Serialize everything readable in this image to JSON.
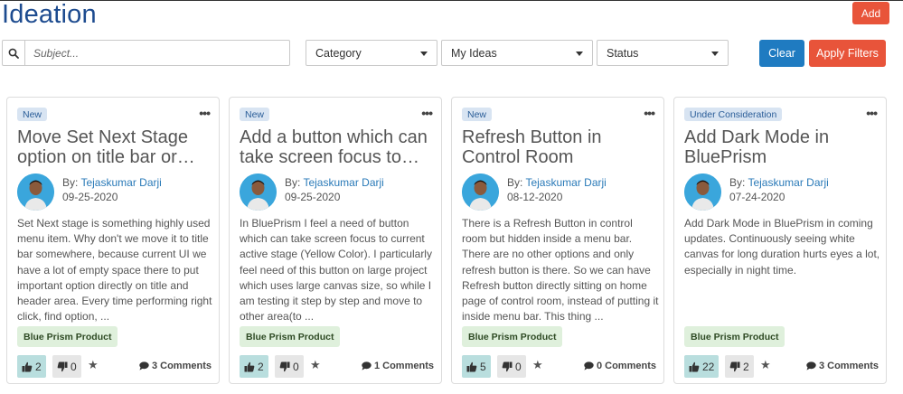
{
  "header": {
    "title": "Ideation",
    "add_label": "Add"
  },
  "filters": {
    "search_placeholder": "Subject...",
    "category": "Category",
    "my_ideas": "My Ideas",
    "status": "Status",
    "clear_label": "Clear",
    "apply_label": "Apply Filters"
  },
  "cards": [
    {
      "status": "New",
      "title": "Move Set Next Stage option on title bar or header",
      "by_label": "By:",
      "author": "Tejaskumar Darji",
      "date": "09-25-2020",
      "description": "Set Next stage is something highly used menu item. Why don't we move it to title bar somewhere, because current UI we have a lot of empty space there to put important option directly on title and header area. Every time performing right click, find option, ...",
      "tag": "Blue Prism Product",
      "upvotes": "2",
      "downvotes": "0",
      "comments": "3 Comments"
    },
    {
      "status": "New",
      "title": "Add a button which can take screen focus to current stage",
      "by_label": "By:",
      "author": "Tejaskumar Darji",
      "date": "09-25-2020",
      "description": "In BluePrism I feel a need of button which can take screen focus to current active stage (Yellow Color). I particularly feel need of this button on large project which uses large canvas size, so while I am testing it step by step and move to other area(to ...",
      "tag": "Blue Prism Product",
      "upvotes": "2",
      "downvotes": "0",
      "comments": "1 Comments"
    },
    {
      "status": "New",
      "title": "Refresh Button in Control Room",
      "by_label": "By:",
      "author": "Tejaskumar Darji",
      "date": "08-12-2020",
      "description": "There is a Refresh Button in control room but hidden inside a menu bar. There are no other options and only refresh button is there. So we can have Refresh button directly sitting on home page of control room, instead of putting it inside menu bar. This thing ...",
      "tag": "Blue Prism Product",
      "upvotes": "5",
      "downvotes": "0",
      "comments": "0 Comments"
    },
    {
      "status": "Under Consideration",
      "title": "Add Dark Mode in BluePrism",
      "by_label": "By:",
      "author": "Tejaskumar Darji",
      "date": "07-24-2020",
      "description": "Add Dark Mode in BluePrism in coming updates. Continuously seeing white canvas for long duration hurts eyes a lot, especially in night time.",
      "tag": "Blue Prism Product",
      "upvotes": "22",
      "downvotes": "2",
      "comments": "3 Comments"
    }
  ],
  "icons": {
    "search": "search-icon",
    "more": "more-options-icon",
    "thumbs_up": "thumbs-up-icon",
    "thumbs_down": "thumbs-down-icon",
    "star": "star-icon",
    "comment": "comment-icon"
  },
  "colors": {
    "title": "#1d4b8f",
    "accent_red": "#e8543a",
    "accent_blue": "#1f7bc1",
    "badge_bg": "#d8e4f2",
    "tag_bg": "#dff0dc",
    "upvote_bg": "#b9dede"
  }
}
